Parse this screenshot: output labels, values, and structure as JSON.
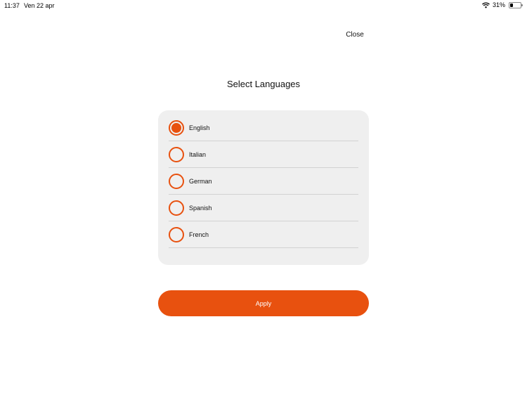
{
  "status_bar": {
    "time": "11:37",
    "date": "Ven 22 apr",
    "battery_percent_label": "31%",
    "battery_level": 0.31
  },
  "header": {
    "close_label": "Close",
    "title": "Select Languages"
  },
  "languages": [
    {
      "label": "English",
      "selected": true
    },
    {
      "label": "Italian",
      "selected": false
    },
    {
      "label": "German",
      "selected": false
    },
    {
      "label": "Spanish",
      "selected": false
    },
    {
      "label": "French",
      "selected": false
    }
  ],
  "actions": {
    "apply_label": "Apply"
  },
  "colors": {
    "accent": "#e8510f",
    "card_background": "#efefef",
    "divider": "#d2d2d2"
  },
  "icons": {
    "wifi": "wifi-icon",
    "battery": "battery-icon",
    "radio": "radio-icon"
  }
}
